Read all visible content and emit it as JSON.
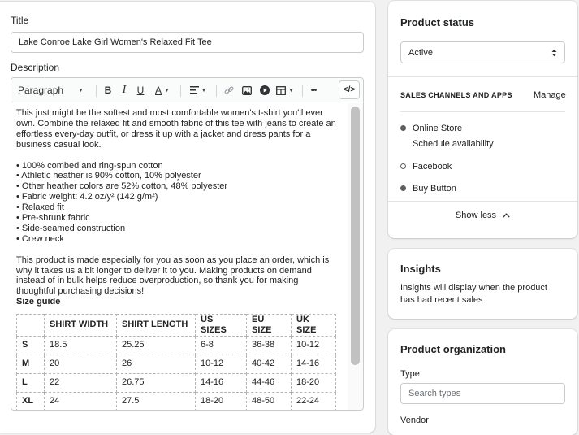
{
  "product": {
    "title_label": "Title",
    "title_value": "Lake Conroe Lake Girl Women's Relaxed Fit Tee",
    "description_label": "Description"
  },
  "toolbar": {
    "paragraph_label": "Paragraph",
    "bold": "B",
    "italic": "I",
    "underline": "U",
    "text_color": "A",
    "more": "•••",
    "code": "</>"
  },
  "description": {
    "intro": "This just might be the softest and most comfortable women's t-shirt you'll ever own. Combine the relaxed fit and smooth fabric of this tee with jeans to create an effortless everyday outfit, or dress it up with a jacket and dress pants for a business casual look.",
    "intro_lines": [
      "This just might be the softest and most comfortable women's t-shirt you'll ever",
      "own. Combine the relaxed fit and smooth fabric of this tee with jeans to create an",
      "effortless every-day outfit, or dress it up with a jacket and dress pants for a",
      "business casual look."
    ],
    "bullets": [
      "• 100% combed and ring-spun cotton",
      "• Athletic heather is 90% cotton, 10% polyester",
      "• Other heather colors are 52% cotton, 48% polyester",
      "• Fabric weight: 4.2 oz/y² (142 g/m²)",
      "• Relaxed fit",
      "• Pre-shrunk fabric",
      "• Side-seamed construction",
      "• Crew neck"
    ],
    "outro_lines": [
      "This product is made especially for you as soon as you place an order, which is",
      "why it takes us a bit longer to deliver it to you. Making products on demand",
      "instead of in bulk helps reduce overproduction, so thank you for making",
      "thoughtful purchasing decisions!"
    ],
    "size_guide_label": "Size guide",
    "size_table": {
      "headers": [
        "",
        "SHIRT WIDTH",
        "SHIRT LENGTH",
        "US SIZES",
        "EU SIZE",
        "UK SIZE"
      ],
      "rows": [
        [
          "S",
          "18.5",
          "25.25",
          "6-8",
          "36-38",
          "10-12"
        ],
        [
          "M",
          "20",
          "26",
          "10-12",
          "40-42",
          "14-16"
        ],
        [
          "L",
          "22",
          "26.75",
          "14-16",
          "44-46",
          "18-20"
        ],
        [
          "XL",
          "24",
          "27.5",
          "18-20",
          "48-50",
          "22-24"
        ]
      ]
    }
  },
  "status_card": {
    "title": "Product status",
    "status_value": "Active",
    "channels_heading": "SALES CHANNELS AND APPS",
    "manage_label": "Manage",
    "channels": [
      {
        "name": "Online Store",
        "active": true,
        "sub": "Schedule availability"
      },
      {
        "name": "Facebook",
        "active": false
      },
      {
        "name": "Buy Button",
        "active": true
      }
    ],
    "show_less": "Show less"
  },
  "insights_card": {
    "title": "Insights",
    "text_line1": "Insights will display when the product",
    "text_line2": "has had recent sales"
  },
  "org_card": {
    "title": "Product organization",
    "type_label": "Type",
    "type_placeholder": "Search types",
    "vendor_label": "Vendor"
  },
  "colors": {
    "active_dot": "#5c5f62",
    "border": "#c9cccf"
  }
}
